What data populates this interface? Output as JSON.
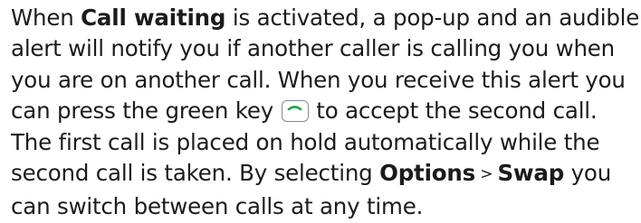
{
  "paragraph": {
    "l1_pre": "When ",
    "l1_bold": "Call waiting",
    "l1_post": " is activated, a pop-up and an audible",
    "l2": "alert will notify you if another caller is calling you when",
    "l3": "you are on another call. When you receive this alert you",
    "l4_pre": "can press the green key ",
    "l4_post": " to accept the second call.",
    "l5": "The first call is placed on hold automatically while the",
    "l6_pre": "second call is taken. By selecting ",
    "l6_bold1": "Options",
    "l6_sep": " > ",
    "l6_bold2": "Swap",
    "l6_post": " you",
    "l7": "can switch between calls at any time."
  },
  "icons": {
    "key": "green-call-key-icon",
    "key_color": "#1fa34a"
  }
}
